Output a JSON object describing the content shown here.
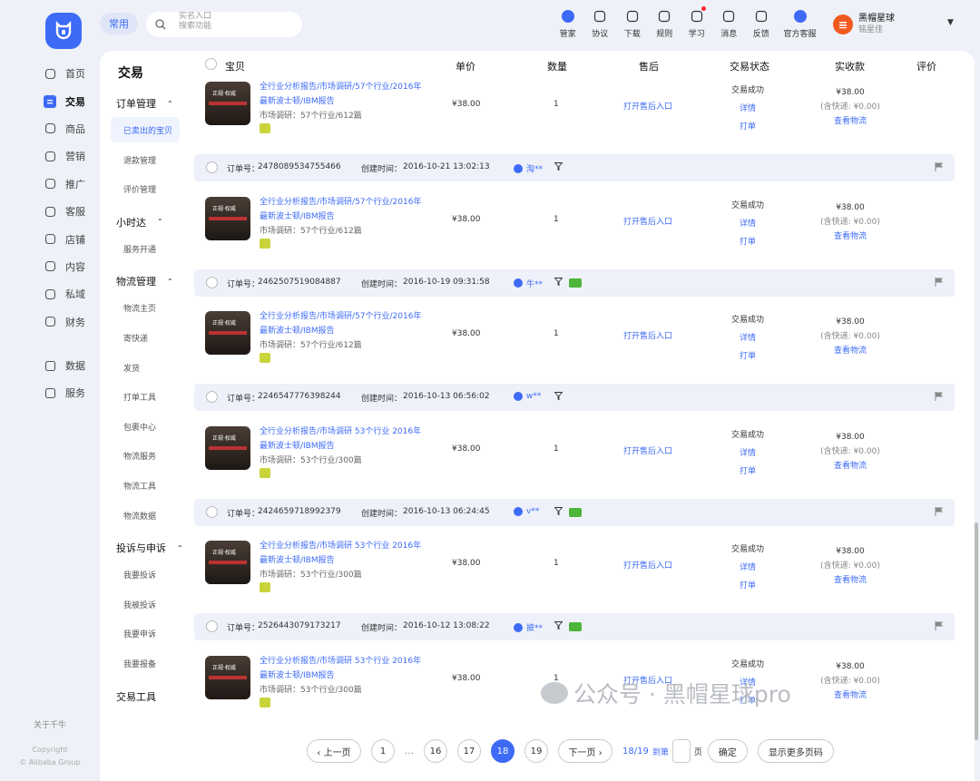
{
  "rail": {
    "items": [
      {
        "label": "首页",
        "icon": "home-icon"
      },
      {
        "label": "交易",
        "icon": "trade-icon",
        "active": true
      },
      {
        "label": "商品",
        "icon": "goods-icon"
      },
      {
        "label": "营销",
        "icon": "megaphone-icon"
      },
      {
        "label": "推广",
        "icon": "promote-icon"
      },
      {
        "label": "客服",
        "icon": "headset-icon"
      },
      {
        "label": "店铺",
        "icon": "store-icon"
      },
      {
        "label": "内容",
        "icon": "content-icon"
      },
      {
        "label": "私域",
        "icon": "private-icon"
      },
      {
        "label": "财务",
        "icon": "finance-icon"
      }
    ],
    "items2": [
      {
        "label": "数据",
        "icon": "chart-icon"
      },
      {
        "label": "服务",
        "icon": "grid-icon"
      }
    ],
    "about": "关于千牛",
    "copyright1": "Copyright",
    "copyright2": "© Alibaba Group"
  },
  "topbar": {
    "pill": "常用",
    "search_line1": "实名入口",
    "search_line2": "搜索功能",
    "tools": [
      {
        "label": "管家",
        "icon": "butler-icon"
      },
      {
        "label": "协议",
        "icon": "agreement-icon"
      },
      {
        "label": "下载",
        "icon": "download-icon"
      },
      {
        "label": "规则",
        "icon": "rules-icon"
      },
      {
        "label": "学习",
        "icon": "learn-icon"
      },
      {
        "label": "消息",
        "icon": "message-icon"
      },
      {
        "label": "反馈",
        "icon": "feedback-icon"
      },
      {
        "label": "官方客服",
        "icon": "service-icon"
      }
    ],
    "user_name": "黑帽星球",
    "user_sub": "铭星佳"
  },
  "side": {
    "title": "交易",
    "groups": [
      {
        "label": "订单管理",
        "subs": [
          "已卖出的宝贝",
          "退款管理",
          "评价管理"
        ]
      },
      {
        "label": "小时达",
        "subs": [
          "服务开通"
        ]
      },
      {
        "label": "物流管理",
        "subs": [
          "物流主页",
          "寄快递",
          "发货",
          "打单工具",
          "包裹中心",
          "物流服务",
          "物流工具",
          "物流数据"
        ]
      },
      {
        "label": "投诉与申诉",
        "subs": [
          "我要投诉",
          "我被投诉",
          "我要申诉",
          "我要报备"
        ]
      },
      {
        "label": "交易工具",
        "subs": []
      }
    ]
  },
  "table": {
    "headers": [
      "宝贝",
      "单价",
      "数量",
      "售后",
      "交易状态",
      "实收款",
      "评价"
    ]
  },
  "labels": {
    "order_no": "订单号：",
    "created": "创建时间：",
    "desc_prefix": "市场调研：",
    "after_sale": "打开售后入口",
    "status": "交易成功",
    "detail": "详情",
    "print": "打单",
    "freight": "(含快递: ¥0.00)",
    "logistics": "查看物流"
  },
  "orders": [
    {
      "order_no": "",
      "time": "",
      "buyer": "",
      "title": "全行业分析报告/市场调研/57个行业/2016年最新波士顿/IBM报告",
      "desc": "57个行业/612篇",
      "price": "¥38.00",
      "qty": "1",
      "paid": "¥38.00",
      "chat": false
    },
    {
      "order_no": "2478089534755466",
      "time": "2016-10-21 13:02:13",
      "buyer": "淘**",
      "title": "全行业分析报告/市场调研/57个行业/2016年最新波士顿/IBM报告",
      "desc": "57个行业/612篇",
      "price": "¥38.00",
      "qty": "1",
      "paid": "¥38.00",
      "chat": false
    },
    {
      "order_no": "2462507519084887",
      "time": "2016-10-19 09:31:58",
      "buyer": "牛**",
      "title": "全行业分析报告/市场调研/57个行业/2016年最新波士顿/IBM报告",
      "desc": "57个行业/612篇",
      "price": "¥38.00",
      "qty": "1",
      "paid": "¥38.00",
      "chat": true
    },
    {
      "order_no": "2246547776398244",
      "time": "2016-10-13 06:56:02",
      "buyer": "w**",
      "title": "全行业分析报告/市场调研 53个行业 2016年最新波士顿/IBM报告",
      "desc": "53个行业/300篇",
      "price": "¥38.00",
      "qty": "1",
      "paid": "¥38.00",
      "chat": false
    },
    {
      "order_no": "2424659718992379",
      "time": "2016-10-13 06:24:45",
      "buyer": "v**",
      "title": "全行业分析报告/市场调研 53个行业 2016年最新波士顿/IBM报告",
      "desc": "53个行业/300篇",
      "price": "¥38.00",
      "qty": "1",
      "paid": "¥38.00",
      "chat": true
    },
    {
      "order_no": "2526443079173217",
      "time": "2016-10-12 13:08:22",
      "buyer": "披**",
      "title": "全行业分析报告/市场调研 53个行业 2016年最新波士顿/IBM报告",
      "desc": "53个行业/300篇",
      "price": "¥38.00",
      "qty": "1",
      "paid": "¥38.00",
      "chat": true
    }
  ],
  "thumb_text": "正规·权威",
  "pager": {
    "prev": "‹ 上一页",
    "pages": [
      "1",
      "…",
      "16",
      "17",
      "18",
      "19"
    ],
    "current": "18",
    "next": "下一页 ›",
    "info": "18/19",
    "goto": "到第",
    "page_unit": "页",
    "confirm": "确定",
    "more": "显示更多页码"
  },
  "watermark": "公众号 · 黑帽星球pro",
  "colors": {
    "accent": "#3d6bf6",
    "bg": "#eef1f7",
    "order_head": "#eef1f9",
    "chat_green": "#4cb53a"
  }
}
